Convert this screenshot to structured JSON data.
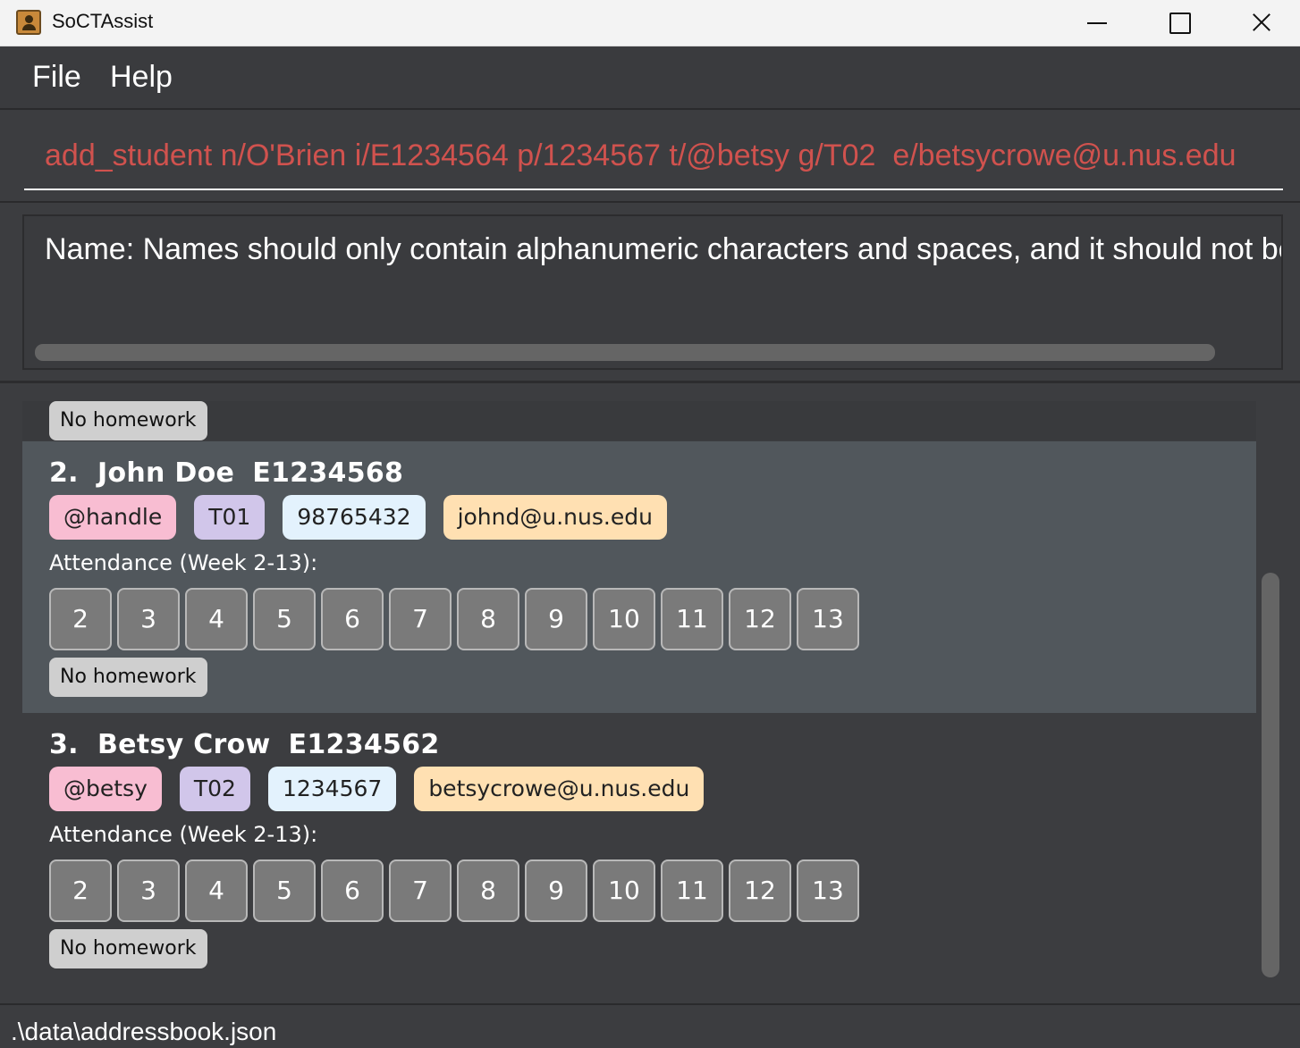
{
  "window": {
    "title": "SoCTAssist",
    "icons": [
      "contact-book-icon",
      "minimize-icon",
      "maximize-icon",
      "close-icon"
    ]
  },
  "menu": {
    "file": "File",
    "help": "Help"
  },
  "command": {
    "value": "add_student n/O'Brien i/E1234564 p/1234567 t/@betsy g/T02  e/betsycrowe@u.nus.edu",
    "text_color": "#d0524e"
  },
  "result": {
    "text": "Name: Names should only contain alphanumeric characters and spaces, and it should not be blank"
  },
  "list": {
    "partial_card": {
      "homework": "No homework"
    },
    "students": [
      {
        "index": "2.",
        "name": "John Doe",
        "id": "E1234568",
        "tag": "@handle",
        "group": "T01",
        "phone": "98765432",
        "email": "johnd@u.nus.edu",
        "attendance_label": "Attendance (Week 2-13):",
        "weeks": [
          "2",
          "3",
          "4",
          "5",
          "6",
          "7",
          "8",
          "9",
          "10",
          "11",
          "12",
          "13"
        ],
        "homework": "No homework",
        "selected": true
      },
      {
        "index": "3.",
        "name": "Betsy Crow",
        "id": "E1234562",
        "tag": "@betsy",
        "group": "T02",
        "phone": "1234567",
        "email": "betsycrowe@u.nus.edu",
        "attendance_label": "Attendance (Week 2-13):",
        "weeks": [
          "2",
          "3",
          "4",
          "5",
          "6",
          "7",
          "8",
          "9",
          "10",
          "11",
          "12",
          "13"
        ],
        "homework": "No homework",
        "selected": false
      }
    ]
  },
  "status": {
    "file_path": ".\\data\\addressbook.json"
  },
  "colors": {
    "tag": "#f8bdd2",
    "group": "#d1c6ea",
    "phone": "#e3f2fd",
    "email": "#ffe0b2",
    "selected_card": "#51575c",
    "background": "#3c3d40"
  }
}
